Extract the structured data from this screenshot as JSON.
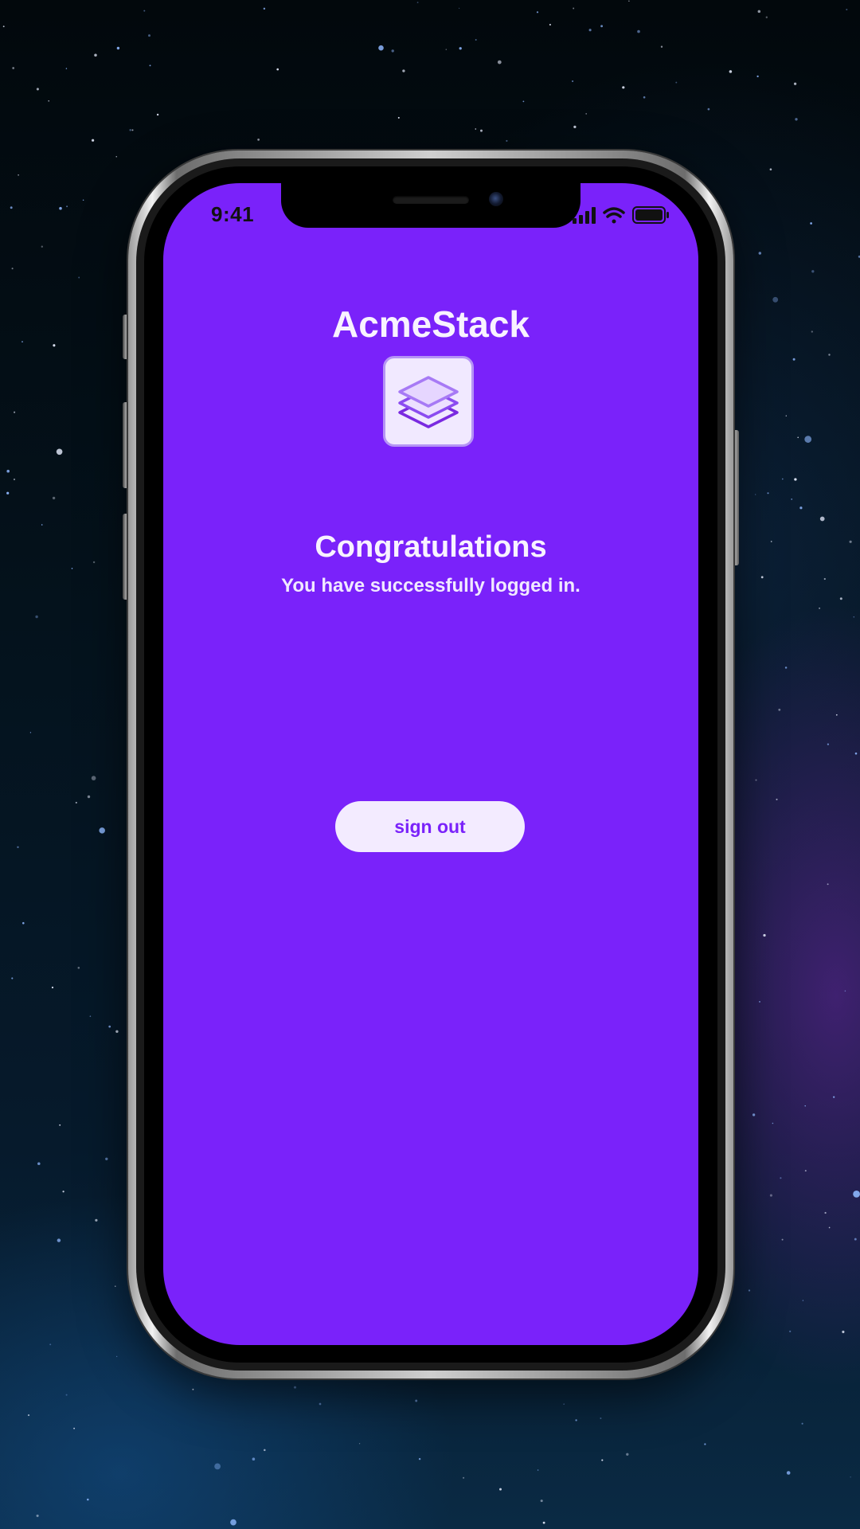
{
  "status_bar": {
    "time": "9:41",
    "icons": [
      "signal-icon",
      "wifi-icon",
      "battery-icon"
    ]
  },
  "app": {
    "title": "AcmeStack",
    "logo_icon": "stacked-layers-icon"
  },
  "message": {
    "title": "Congratulations",
    "subtitle": "You have successfully logged in."
  },
  "actions": {
    "sign_out_label": "sign out"
  },
  "colors": {
    "screen_background": "#7a22fa",
    "text_light": "#f8f2ff",
    "button_background": "#f3ebff",
    "button_text": "#7a22fa",
    "logo_background": "#f1e9ff",
    "logo_stroke": "#8b4cf0"
  }
}
